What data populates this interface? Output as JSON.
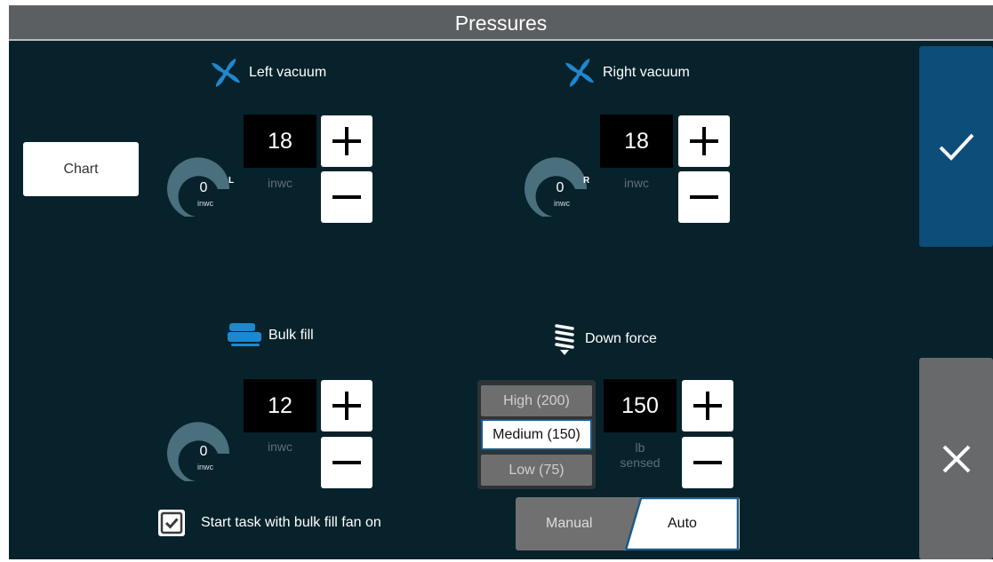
{
  "title": "Pressures",
  "colors": {
    "background": "#07222b",
    "accent_blue": "#0c4d79",
    "fan_blue": "#1e88cf",
    "gauge": "#4a6f7d"
  },
  "chart_button": {
    "label": "Chart"
  },
  "left_vacuum": {
    "label": "Left vacuum",
    "icon": "fan-icon",
    "setpoint": "18",
    "unit": "inwc",
    "gauge_value": "0",
    "gauge_unit": "inwc",
    "side": "L"
  },
  "right_vacuum": {
    "label": "Right vacuum",
    "icon": "fan-icon",
    "setpoint": "18",
    "unit": "inwc",
    "gauge_value": "0",
    "gauge_unit": "inwc",
    "side": "R"
  },
  "bulk_fill": {
    "label": "Bulk fill",
    "icon": "bulk-fill-icon",
    "setpoint": "12",
    "unit": "inwc",
    "gauge_value": "0",
    "gauge_unit": "inwc",
    "fan_option": {
      "label": "Start task with bulk fill fan on",
      "checked": true
    }
  },
  "down_force": {
    "label": "Down force",
    "icon": "spring-icon",
    "setpoint": "150",
    "unit_line1": "lb",
    "unit_line2": "sensed",
    "options": [
      "High (200)",
      "Medium (150)",
      "Low (75)"
    ],
    "selected": "Medium (150)",
    "mode": {
      "manual": "Manual",
      "auto": "Auto",
      "selected": "Auto"
    }
  },
  "side_buttons": {
    "confirm_icon": "checkmark-icon",
    "cancel_icon": "close-icon"
  }
}
